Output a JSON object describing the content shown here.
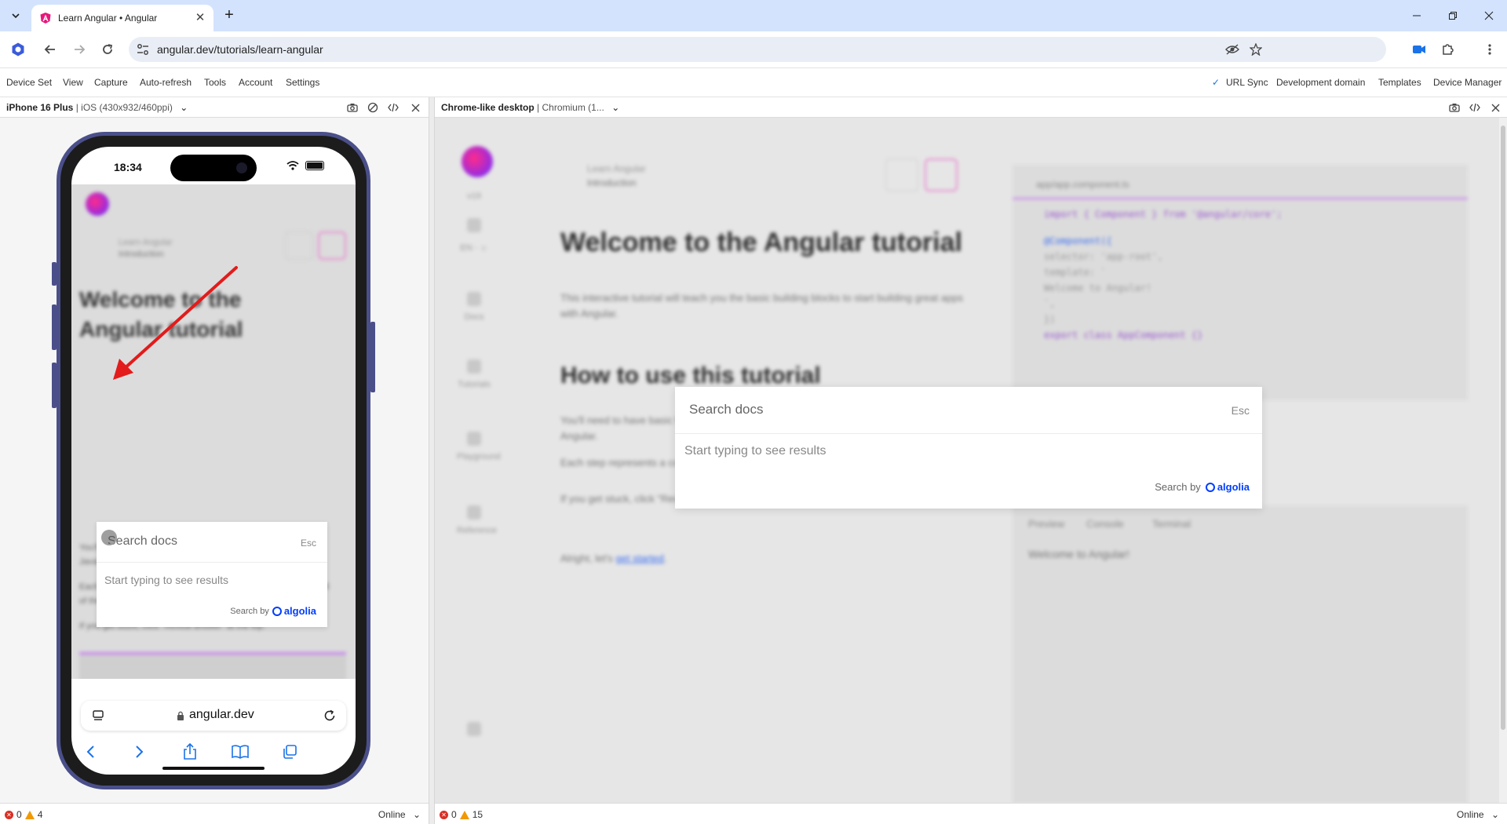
{
  "browser": {
    "tab_title": "Learn Angular • Angular",
    "url": "angular.dev/tutorials/learn-angular"
  },
  "menubar": {
    "left": [
      "Device Set",
      "View",
      "Capture",
      "Auto-refresh",
      "Tools",
      "Account",
      "Settings"
    ],
    "right": {
      "url_sync": "URL Sync",
      "development_domain": "Development domain",
      "templates": "Templates",
      "device_manager": "Device Manager"
    }
  },
  "left_pane": {
    "device_name": "iPhone 16 Plus",
    "device_spec": "| iOS (430x932/460ppi)",
    "status": {
      "errors": "0",
      "warnings": "4",
      "network": "Online"
    }
  },
  "right_pane": {
    "device_name": "Chrome-like desktop",
    "device_spec": "| Chromium (1...",
    "status": {
      "errors": "0",
      "warnings": "15",
      "network": "Online"
    }
  },
  "phone": {
    "time": "18:34",
    "address": "angular.dev",
    "search": {
      "placeholder": "Search docs",
      "esc": "Esc",
      "hint": "Start typing to see results",
      "search_by": "Search by",
      "provider": "algolia"
    }
  },
  "desktop": {
    "search": {
      "placeholder": "Search docs",
      "esc": "Esc",
      "hint": "Start typing to see results",
      "search_by": "Search by",
      "provider": "algolia"
    }
  },
  "colors": {
    "accent_blue": "#003dff",
    "annotation_arrow": "#e31b1b",
    "phone_frame": "#4a4f8a",
    "angular_pink": "#e8177c"
  }
}
